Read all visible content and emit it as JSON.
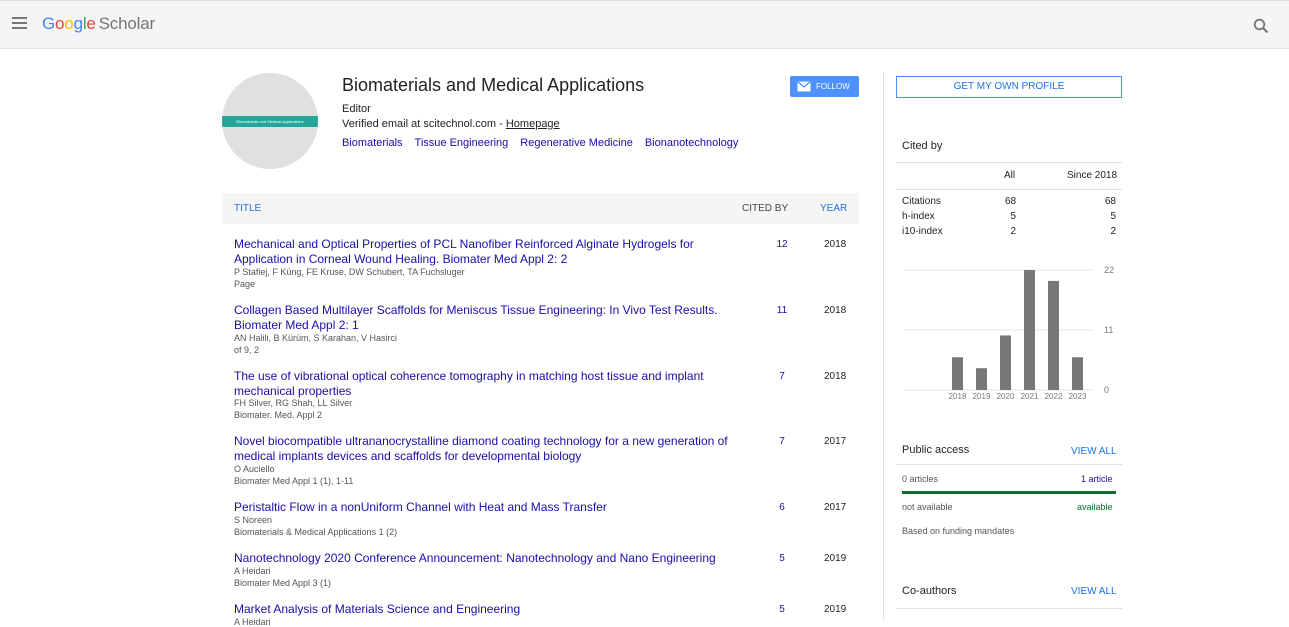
{
  "header": {
    "logo": [
      "G",
      "o",
      "o",
      "g",
      "l",
      "e"
    ],
    "logo_suffix": "Scholar"
  },
  "profile": {
    "avatar_text": "Biomaterials and Medical Applications",
    "name": "Biomaterials and Medical Applications",
    "affiliation": "Editor",
    "email": "Verified email at scitechnol.com - ",
    "homepage_label": "Homepage",
    "interests": [
      "Biomaterials",
      "Tissue Engineering",
      "Regenerative Medicine",
      "Bionanotechnology"
    ],
    "follow_label": "FOLLOW"
  },
  "table": {
    "headers": {
      "title": "TITLE",
      "cited_by": "CITED BY",
      "year": "YEAR"
    },
    "rows": [
      {
        "title": "Mechanical and Optical Properties of PCL Nanofiber Reinforced Alginate Hydrogels for Application in Corneal Wound Healing. Biomater Med Appl 2: 2",
        "authors": "P Stafiej, F Küng, FE Kruse, DW Schubert, TA Fuchsluger",
        "venue": "Page",
        "cited": "12",
        "year": "2018"
      },
      {
        "title": "Collagen Based Multilayer Scaffolds for Meniscus Tissue Engineering: In Vivo Test Results. Biomater Med Appl 2: 1",
        "authors": "AN Halili, B Kürüm, S Karahan, V Hasirci",
        "venue": "of 9, 2",
        "cited": "11",
        "year": "2018"
      },
      {
        "title": "The use of vibrational optical coherence tomography in matching host tissue and implant mechanical properties",
        "authors": "FH Silver, RG Shah, LL Silver",
        "venue": "Biomater. Med. Appl 2",
        "cited": "7",
        "year": "2018"
      },
      {
        "title": "Novel biocompatible ultrananocrystalline diamond coating technology for a new generation of medical implants devices and scaffolds for developmental biology",
        "authors": "O Auciello",
        "venue": "Biomater Med Appl 1 (1), 1-11",
        "cited": "7",
        "year": "2017"
      },
      {
        "title": "Peristaltic Flow in a nonUniform Channel with Heat and Mass Transfer",
        "authors": "S Noreen",
        "venue": "Biomaterials & Medical Applications 1 (2)",
        "cited": "6",
        "year": "2017"
      },
      {
        "title": "Nanotechnology 2020 Conference Announcement: Nanotechnology and Nano Engineering",
        "authors": "A Heidari",
        "venue": "Biomater Med Appl 3 (1)",
        "cited": "5",
        "year": "2019"
      },
      {
        "title": "Market Analysis of Materials Science and Engineering",
        "authors": "A Heidari",
        "venue": "",
        "cited": "5",
        "year": "2019"
      }
    ]
  },
  "sidebar": {
    "own_profile_label": "GET MY OWN PROFILE",
    "cited_by": {
      "title": "Cited by",
      "col_all": "All",
      "col_since": "Since 2018",
      "stats": [
        {
          "label": "Citations",
          "all": "68",
          "since": "68"
        },
        {
          "label": "h-index",
          "all": "5",
          "since": "5"
        },
        {
          "label": "i10-index",
          "all": "2",
          "since": "2"
        }
      ]
    },
    "public_access": {
      "title": "Public access",
      "view_all": "VIEW ALL",
      "articles_left": "0 articles",
      "articles_right": "1 article",
      "not_available": "not available",
      "available": "available",
      "note": "Based on funding mandates"
    },
    "coauthors": {
      "title": "Co-authors",
      "view_all": "VIEW ALL"
    }
  },
  "chart_data": {
    "type": "bar",
    "categories": [
      "2018",
      "2019",
      "2020",
      "2021",
      "2022",
      "2023"
    ],
    "values": [
      6,
      4,
      10,
      22,
      20,
      6
    ],
    "yticks": [
      "0",
      "11",
      "22"
    ],
    "ylim": [
      0,
      22
    ],
    "bar_color": "#777777",
    "grid": true
  }
}
